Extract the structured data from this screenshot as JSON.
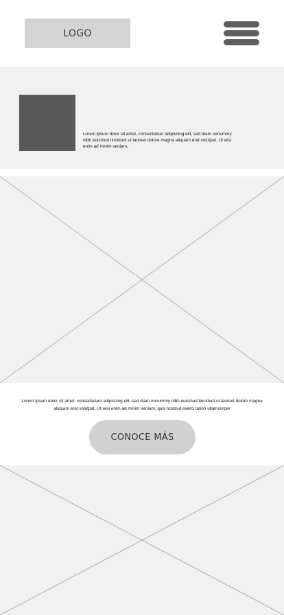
{
  "header": {
    "logo_label": "LOGO",
    "menu_icon": "hamburger-menu-icon"
  },
  "intro": {
    "thumbnail": "image-placeholder",
    "text": "Lorem ipsum dolor sit amet, consectetuer adipiscing elit, sed diam nonummy nibh euismod tincidunt ut laoreet dolore magna aliquam erat volutpat. Ut wisi enim ad minim veniam,"
  },
  "hero": {
    "placeholder_icon": "image-placeholder-cross"
  },
  "cta": {
    "text": "Lorem ipsum dolor sit amet, consectetuer adipiscing elit, sed diam nonummy nibh euismod tincidunt ut laoreet dolore magna aliquam erat volutpat. Ut wisi enim ad minim veniam, quis nostrud exerci tation ullamcorper",
    "button_label": "CONOCE MÁS"
  },
  "footer_media": {
    "placeholder_icon": "image-placeholder-cross"
  },
  "colors": {
    "placeholder_bg": "#f1f1f3",
    "dark_block": "#58585a",
    "button_bg": "#d1d1d1",
    "menu_bars": "#5e5e60"
  }
}
